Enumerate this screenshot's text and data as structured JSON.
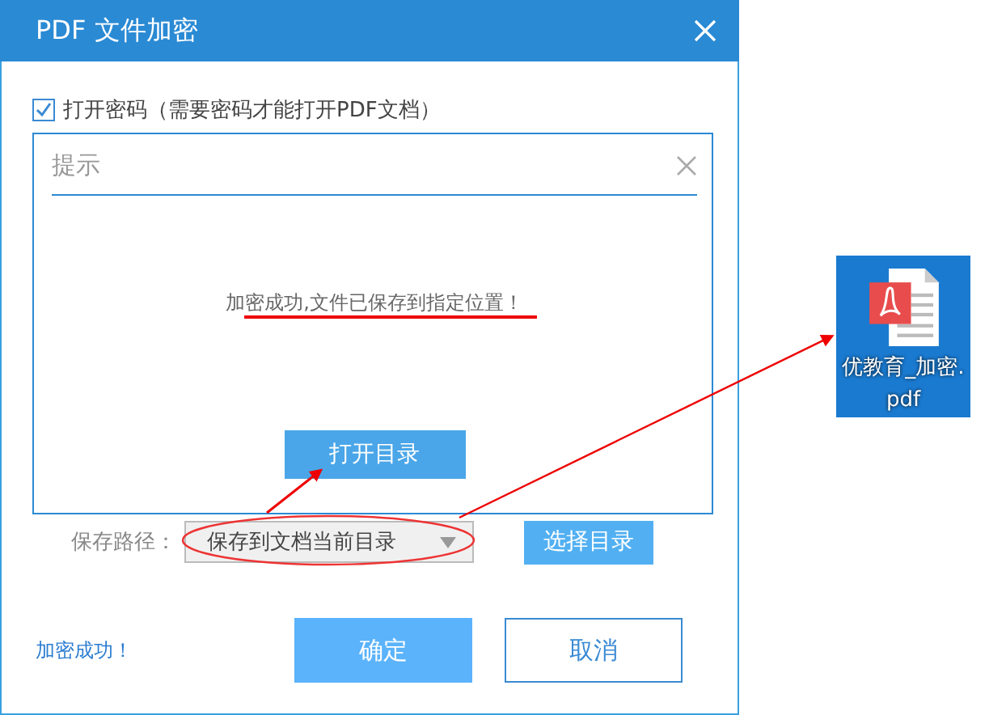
{
  "dialog": {
    "title": "PDF 文件加密",
    "password_option": {
      "label": "打开密码（需要密码才能打开PDF文档）",
      "checked": true
    },
    "notice": {
      "title": "提示",
      "message": "加密成功,文件已保存到指定位置！",
      "button": "打开目录"
    },
    "save_path": {
      "label": "保存路径：",
      "value": "保存到文档当前目录",
      "button": "选择目录"
    },
    "status": "加密成功！",
    "buttons": [
      {
        "label": "确定",
        "kind": "primary"
      },
      {
        "label": "取消",
        "kind": "secondary"
      }
    ]
  },
  "desktop_file": {
    "name": "优教育_加密.pdf",
    "selected": true
  }
}
